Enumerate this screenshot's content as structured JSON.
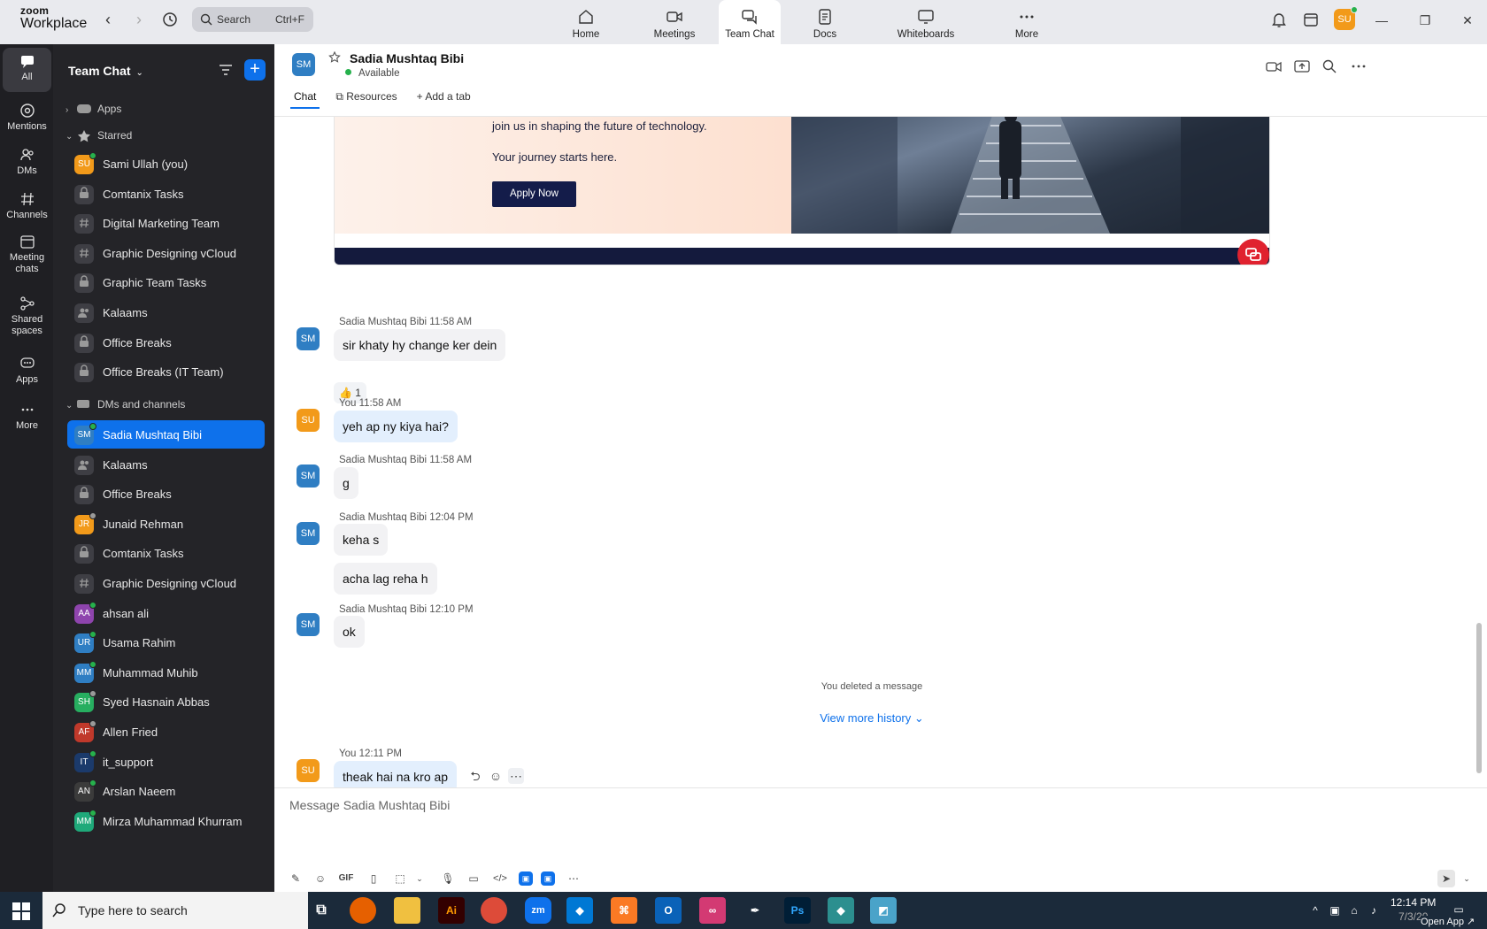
{
  "app": {
    "brand_line1": "zoom",
    "brand_line2": "Workplace",
    "search_placeholder": "Search",
    "search_shortcut": "Ctrl+F",
    "user_initials": "SU"
  },
  "top_tabs": [
    {
      "label": "Home",
      "icon": "home-icon"
    },
    {
      "label": "Meetings",
      "icon": "video-icon"
    },
    {
      "label": "Team Chat",
      "icon": "chat-icon",
      "active": true
    },
    {
      "label": "Docs",
      "icon": "doc-icon"
    },
    {
      "label": "Whiteboards",
      "icon": "whiteboard-icon"
    },
    {
      "label": "More",
      "icon": "more-icon"
    }
  ],
  "rail": [
    {
      "label": "All",
      "active": true
    },
    {
      "label": "Mentions"
    },
    {
      "label": "DMs"
    },
    {
      "label": "Channels"
    },
    {
      "label": "Meeting chats"
    },
    {
      "label": "Shared spaces"
    },
    {
      "label": "Apps"
    },
    {
      "label": "More"
    }
  ],
  "sidebar": {
    "title": "Team Chat",
    "apps_label": "Apps",
    "starred_label": "Starred",
    "dms_label": "DMs and channels",
    "starred": [
      {
        "name": "Sami Ullah (you)",
        "initials": "SU",
        "color": "#f29a1a",
        "status": "online"
      },
      {
        "name": "Comtanix Tasks",
        "icon": "lock"
      },
      {
        "name": "Digital Marketing Team",
        "icon": "hash"
      },
      {
        "name": "Graphic Designing vCloud",
        "icon": "hash"
      },
      {
        "name": "Graphic Team Tasks",
        "icon": "lock"
      },
      {
        "name": "Kalaams",
        "icon": "group"
      },
      {
        "name": "Office Breaks",
        "icon": "lock"
      },
      {
        "name": "Office Breaks (IT Team)",
        "icon": "lock"
      }
    ],
    "dms": [
      {
        "name": "Sadia Mushtaq Bibi",
        "initials": "SM",
        "color": "#2f7ec3",
        "status": "online",
        "selected": true
      },
      {
        "name": "Kalaams",
        "icon": "group"
      },
      {
        "name": "Office Breaks",
        "icon": "lock"
      },
      {
        "name": "Junaid Rehman",
        "initials": "JR",
        "color": "#f29a1a",
        "status": "away"
      },
      {
        "name": "Comtanix Tasks",
        "icon": "lock"
      },
      {
        "name": "Graphic Designing vCloud",
        "icon": "hash"
      },
      {
        "name": "ahsan ali",
        "initials": "AA",
        "color": "#8e44ad",
        "status": "online"
      },
      {
        "name": "Usama Rahim",
        "initials": "UR",
        "color": "#2f7ec3",
        "status": "online"
      },
      {
        "name": "Muhammad Muhib",
        "initials": "MM",
        "color": "#2f7ec3",
        "status": "online"
      },
      {
        "name": "Syed Hasnain Abbas",
        "initials": "SH",
        "color": "#27ae60",
        "status": "away"
      },
      {
        "name": "Allen Fried",
        "initials": "AF",
        "color": "#c0392b",
        "status": "away"
      },
      {
        "name": "it_support",
        "initials": "IT",
        "color": "#1b3a6b",
        "status": "online"
      },
      {
        "name": "Arslan Naeem",
        "initials": "AN",
        "color": "#3b3b3b",
        "status": "online"
      },
      {
        "name": "Mirza Muhammad Khurram",
        "initials": "MM",
        "color": "#1fa97a",
        "status": "online"
      }
    ]
  },
  "chat": {
    "contact_name": "Sadia Mushtaq Bibi",
    "contact_initials": "SM",
    "contact_status": "Available",
    "tabs": [
      "Chat",
      "Resources",
      "Add a tab"
    ],
    "card": {
      "line1": "join us in shaping the future of technology.",
      "line2": "Your journey starts here.",
      "button": "Apply Now"
    },
    "messages": [
      {
        "sender": "Sadia Mushtaq Bibi",
        "time": "11:58 AM",
        "initials": "SM",
        "texts": [
          "sir khaty hy change ker dein"
        ],
        "reaction": "👍 1"
      },
      {
        "sender": "You",
        "time": "11:58 AM",
        "initials": "SU",
        "texts": [
          "yeh ap ny kiya hai?"
        ],
        "me": true
      },
      {
        "sender": "Sadia Mushtaq Bibi",
        "time": "11:58 AM",
        "initials": "SM",
        "texts": [
          "g"
        ]
      },
      {
        "sender": "Sadia Mushtaq Bibi",
        "time": "12:04 PM",
        "initials": "SM",
        "texts": [
          "keha s",
          "acha lag reha h"
        ]
      },
      {
        "sender": "Sadia Mushtaq Bibi",
        "time": "12:10 PM",
        "initials": "SM",
        "texts": [
          "ok"
        ]
      },
      {
        "sender": "You",
        "time": "12:11 PM",
        "initials": "SU",
        "texts": [
          "theak hai na kro ap"
        ],
        "me": true
      }
    ],
    "system_message": "You deleted a message",
    "view_more_history": "View more history",
    "composer_placeholder": "Message Sadia Mushtaq Bibi"
  },
  "taskbar": {
    "search_text": "Type here to search",
    "time": "12:14 PM",
    "date": "7/3/20",
    "open_app": "Open App"
  },
  "colors": {
    "accent": "#0e71eb",
    "sidebar_bg": "#242428",
    "rail_bg": "#1f1f23",
    "online": "#26b14c"
  }
}
